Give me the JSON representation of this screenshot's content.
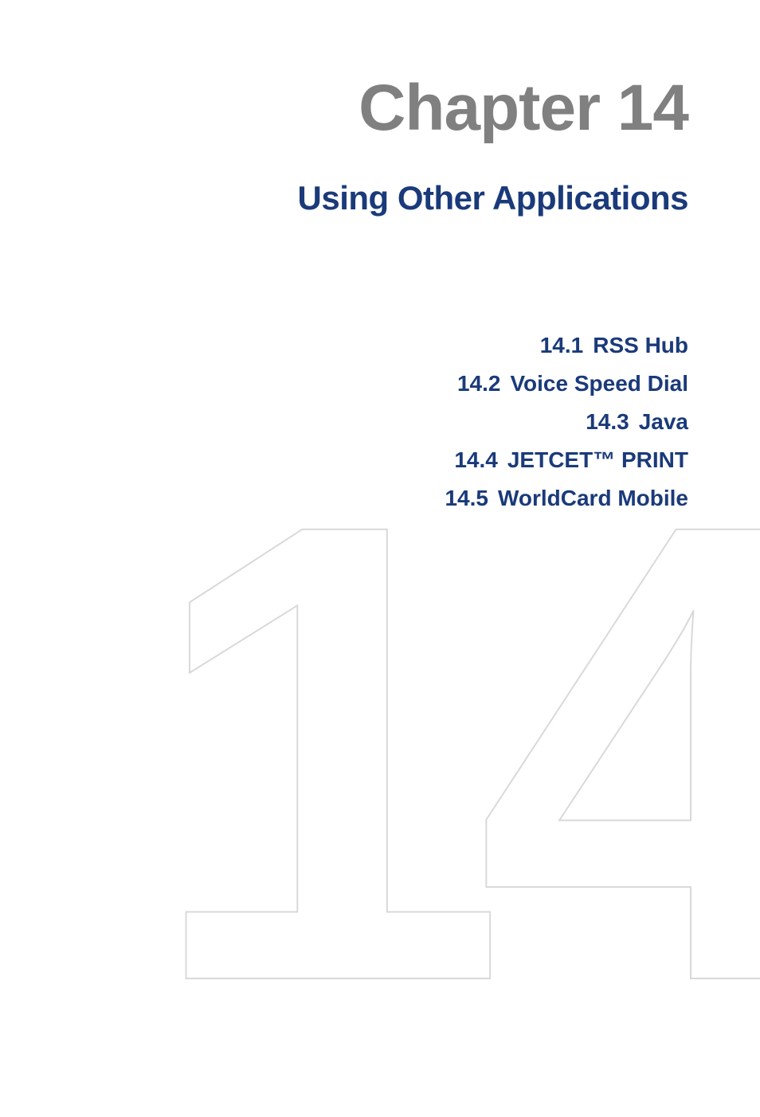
{
  "background_number": "14",
  "chapter": {
    "title": "Chapter 14",
    "subtitle": "Using Other Applications"
  },
  "toc": {
    "items": [
      {
        "number": "14.1",
        "label": "RSS Hub"
      },
      {
        "number": "14.2",
        "label": "Voice Speed Dial"
      },
      {
        "number": "14.3",
        "label": "Java"
      },
      {
        "number": "14.4",
        "label": "JETCET™ PRINT"
      },
      {
        "number": "14.5",
        "label": "WorldCard Mobile"
      }
    ]
  }
}
